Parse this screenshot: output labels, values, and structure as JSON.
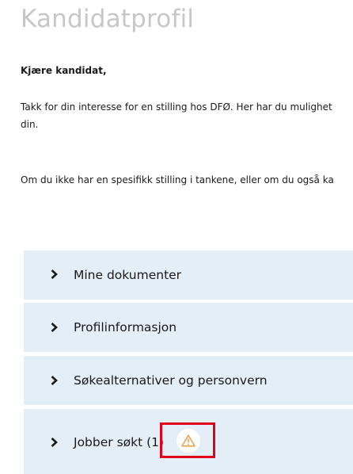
{
  "page": {
    "title": "Kandidatprofil",
    "greeting": "Kjære kandidat,",
    "intro_line1": "Takk for din interesse for en stilling hos DFØ. Her har du mulighet",
    "intro_line2": "din.",
    "intro_para2": "Om du ikke har en spesifikk stilling i tankene, eller om du også ka"
  },
  "accordion": [
    {
      "label": "Mine dokumenter"
    },
    {
      "label": "Profilinformasjon"
    },
    {
      "label": "Søkealternativer og personvern"
    },
    {
      "label": "Jobber søkt (1)"
    }
  ],
  "icons": {
    "chevron": "chevron-right-icon",
    "warning": "warning-triangle-icon"
  },
  "colors": {
    "accordion_bg": "#e3eef6",
    "title": "#c7c7c7",
    "highlight_border": "#e0001b",
    "warning": "#e8a04b"
  }
}
